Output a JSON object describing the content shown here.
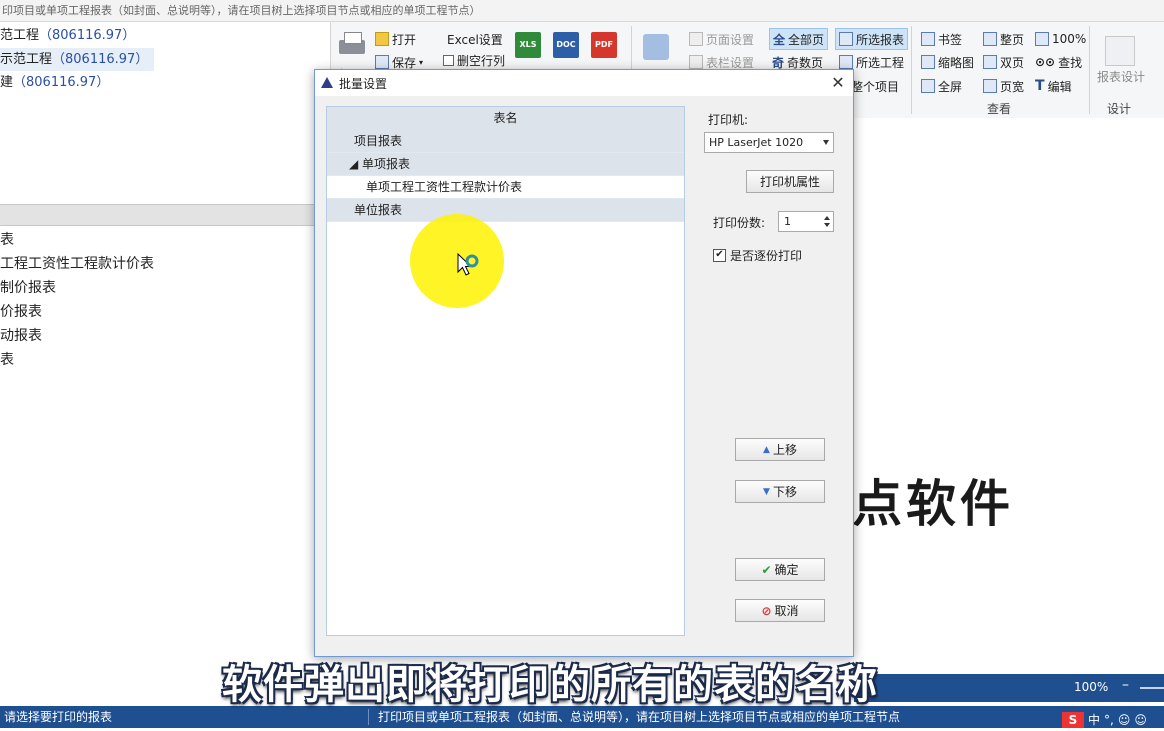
{
  "hint_bar": "印项目或单项工程报表（如封面、总说明等），请在项目树上选择项目节点或相应的单项工程节点）",
  "tree": [
    {
      "label": "范工程",
      "value": "（806116.97）"
    },
    {
      "label": "示范工程",
      "value": "（806116.97）"
    },
    {
      "label": "建",
      "value": "（806116.97）"
    }
  ],
  "report_list": [
    "表",
    "工程工资性工程款计价表",
    "制价报表",
    "价报表",
    "动报表",
    "表"
  ],
  "ribbon": {
    "print": "打印",
    "open": "打开",
    "save": "保存",
    "excel_settings": "Excel设置",
    "delete_empty_rows": "删空行列",
    "export_xls": "XLS",
    "export_doc": "DOC",
    "export_pdf": "PDF",
    "page_setup": "页面设置",
    "header_setup": "表栏设置",
    "all_pages": "全部页",
    "odd_pages": "奇数页",
    "selected_reports": "所选报表",
    "selected_project": "所选工程",
    "whole_project": "整个项目",
    "bookmark": "书签",
    "thumbnail": "缩略图",
    "fullscreen": "全屏",
    "whole_page": "整页",
    "double_page": "双页",
    "page_width": "页宽",
    "zoom_100": "100%",
    "find": "查找",
    "edit": "编辑",
    "view_group": "查看",
    "report_design": "报表设计",
    "design_group": "设计"
  },
  "dialog": {
    "title": "批量设置",
    "table_header": "表名",
    "rows": [
      {
        "label": "项目报表",
        "indent": 1
      },
      {
        "label": "◢ 单项报表",
        "indent": 1
      },
      {
        "label": "单项工程工资性工程款计价表",
        "indent": 2
      },
      {
        "label": "单位报表",
        "indent": 1
      }
    ],
    "printer_label": "打印机:",
    "printer_value": "HP LaserJet 1020",
    "printer_props": "打印机属性",
    "copies_label": "打印份数:",
    "copies_value": "1",
    "collate_label": "是否逐份打印",
    "collate_checked": "✔",
    "move_up": "上移",
    "move_down": "下移",
    "ok": "确定",
    "cancel": "取消"
  },
  "brand_text": "点软件",
  "zoom": "100%",
  "status": {
    "left": "请选择要打印的报表",
    "right": "打印项目或单项工程报表（如封面、总说明等），请在项目树上选择项目节点或相应的单项工程节点"
  },
  "ime": {
    "logo": "S",
    "mode": "中",
    "punct": "°,"
  },
  "subtitle": "软件弹出即将打印的所有的表的名称"
}
